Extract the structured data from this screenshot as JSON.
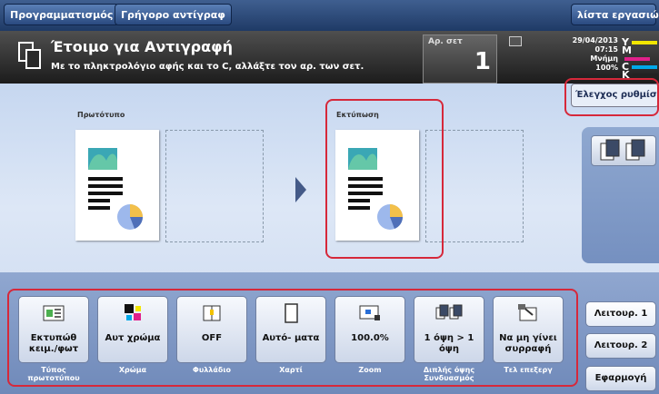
{
  "topbar": {
    "programs_label": "Προγραμματισμός",
    "quick_copy_label": "Γρήγορο αντίγραφ",
    "job_list_label": "λίστα εργασιών"
  },
  "status": {
    "title": "Έτοιμο για Αντιγραφή",
    "message": "Με το πληκτρολόγιο αφής και το C, αλλάξτε τον αρ. των σετ.",
    "sets_label": "Αρ. σετ",
    "sets_value": "1",
    "date": "29/04/2013",
    "time": "07:15",
    "memory_label": "Μνήμη",
    "memory_value": "100%",
    "toner": [
      {
        "letter": "Y",
        "color": "#f2e600"
      },
      {
        "letter": "M",
        "color": "#e0208a"
      },
      {
        "letter": "C",
        "color": "#00a8e8"
      },
      {
        "letter": "K",
        "color": "#222222"
      }
    ]
  },
  "check_settings_label": "Έλεγχος ρυθμίσεων",
  "preview": {
    "original_label": "Πρωτότυπο",
    "output_label": "Εκτύπωση"
  },
  "functions": [
    {
      "value": "Εκτυπώθ κειμ./φωτ",
      "label": "Τύπος πρωτοτύπου",
      "icon": "original-type-icon"
    },
    {
      "value": "Αυτ χρώμα",
      "label": "Χρώμα",
      "icon": "color-icon"
    },
    {
      "value": "OFF",
      "label": "Φυλλάδιο",
      "icon": "booklet-icon"
    },
    {
      "value": "Αυτό- ματα",
      "label": "Χαρτί",
      "icon": "paper-icon"
    },
    {
      "value": "100.0%",
      "label": "Zoom",
      "icon": "zoom-icon"
    },
    {
      "value": "1 όψη > 1 όψη",
      "label": "Διπλής όψης Συνδυασμός",
      "icon": "duplex-icon"
    },
    {
      "value": "Να μη γίνει συρραφή",
      "label": "Τελ επεξεργ",
      "icon": "finishing-icon"
    }
  ],
  "right_tabs": {
    "function1": "Λειτουρ. 1",
    "function2": "Λειτουρ. 2",
    "apply": "Εφαρμογή"
  }
}
